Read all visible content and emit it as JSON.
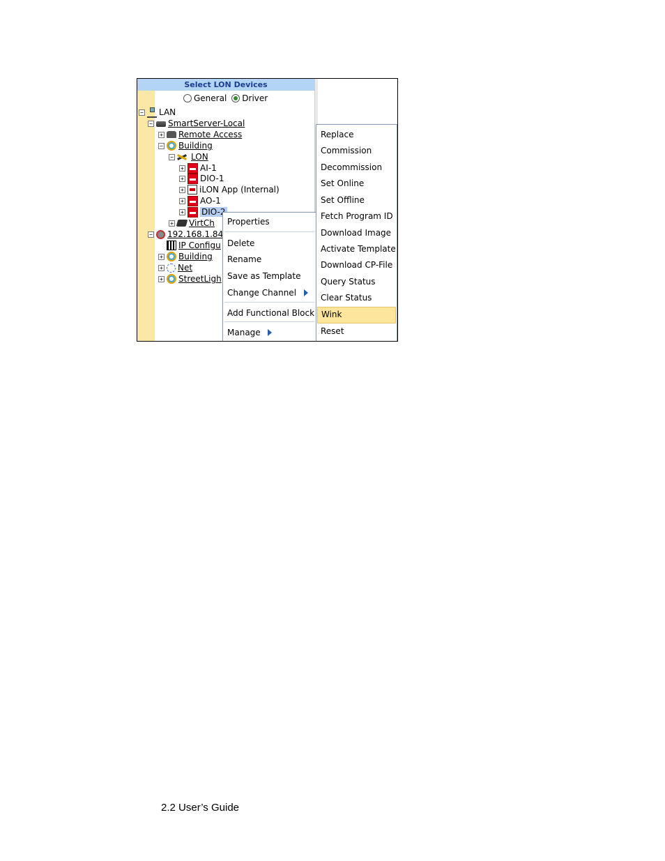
{
  "panel": {
    "title": "Select LON Devices",
    "modes": [
      {
        "label": "General",
        "selected": false
      },
      {
        "label": "Driver",
        "selected": true
      }
    ]
  },
  "tree": {
    "lan": "LAN",
    "smartserver": "SmartServer-Local",
    "remote_access": "Remote Access",
    "building": "Building",
    "lon": "LON",
    "devices": [
      "AI-1",
      "DIO-1",
      "iLON App (Internal)",
      "AO-1",
      "DIO-2"
    ],
    "virtch": "VirtCh",
    "ip_node": "192.168.1.84",
    "ip_config": "IP Configu",
    "building2": "Building",
    "net": "Net",
    "streetlight": "StreetLigh"
  },
  "context_menu": {
    "properties": "Properties",
    "delete": "Delete",
    "rename": "Rename",
    "save_template": "Save as Template",
    "change_channel": "Change Channel",
    "add_fb": "Add Functional Block",
    "manage": "Manage"
  },
  "submenu": {
    "items": [
      "Replace",
      "Commission",
      "Decommission",
      "Set Online",
      "Set Offline",
      "Fetch Program ID",
      "Download Image",
      "Activate Template",
      "Download CP-File",
      "Query Status",
      "Clear Status",
      "Wink",
      "Reset"
    ],
    "highlighted": "Wink"
  },
  "caption": "2.2 User’s Guide",
  "colors": {
    "header_bg": "#b4d4f5",
    "gutter": "#fbe7a6",
    "highlight": "#fde69c",
    "device_red": "#e0001a"
  }
}
